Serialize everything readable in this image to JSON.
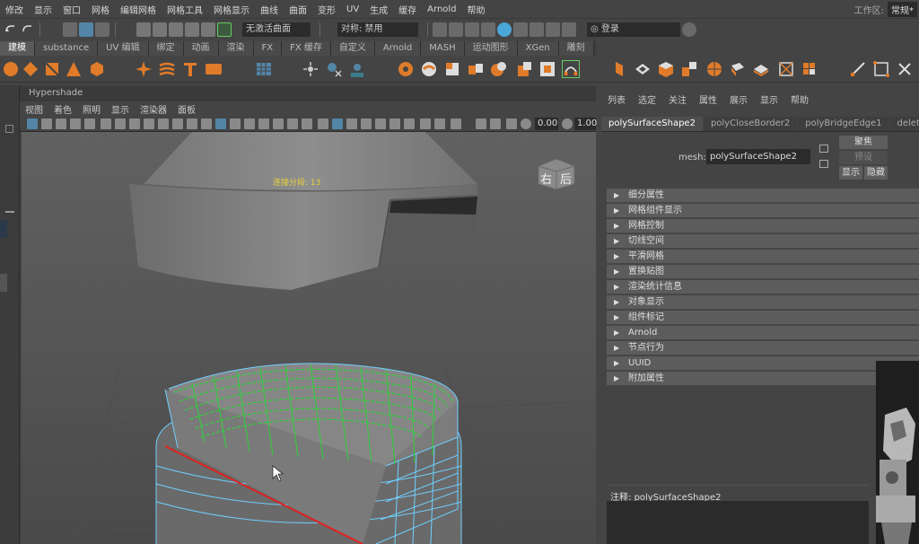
{
  "menubar": {
    "items": [
      "修改",
      "显示",
      "窗口",
      "网格",
      "编辑网格",
      "网格工具",
      "网格显示",
      "曲线",
      "曲面",
      "变形",
      "UV",
      "生成",
      "缓存",
      "Arnold",
      "帮助"
    ],
    "workspace_label": "工作区:",
    "workspace_value": "常规*"
  },
  "statusline": {
    "live_surface": "无激活曲面",
    "symmetry": "对称: 禁用",
    "login": "登录"
  },
  "shelf": {
    "tabs": [
      "建模",
      "substance",
      "UV 编辑",
      "绑定",
      "动画",
      "渲染",
      "FX",
      "FX 缓存",
      "自定义",
      "Arnold",
      "MASH",
      "运动图形",
      "XGen",
      "雕刻"
    ],
    "active_tab": 0
  },
  "viewport": {
    "panel_title": "Hypershade",
    "menu": [
      "视图",
      "着色",
      "照明",
      "显示",
      "渲染器",
      "面板"
    ],
    "near_clip": "0.00",
    "far_clip": "1.00",
    "hud_text": "连接分段: 13",
    "viewcube_right": "右",
    "viewcube_back": "后"
  },
  "attribute_editor": {
    "menu": [
      "列表",
      "选定",
      "关注",
      "属性",
      "展示",
      "显示",
      "帮助"
    ],
    "tabs": [
      "polySurfaceShape2",
      "polyCloseBorder2",
      "polyBridgeEdge1",
      "deleteCom"
    ],
    "mesh_label": "mesh:",
    "mesh_value": "polySurfaceShape2",
    "focus_button": "聚焦",
    "presets_button": "预设",
    "show_button": "显示",
    "hide_button": "隐藏",
    "sections": [
      "细分属性",
      "网格组件显示",
      "网格控制",
      "切线空间",
      "平滑网格",
      "置换贴图",
      "渲染统计信息",
      "对象显示",
      "组件标记",
      "Arnold",
      "节点行为",
      "UUID",
      "附加属性"
    ],
    "notes_label": "注释:",
    "notes_value": "polySurfaceShape2"
  },
  "colors": {
    "accent_orange": "#e07b2a",
    "active_blue": "#5285a6",
    "edge_green": "#2fd13a",
    "edge_red": "#e02020",
    "wire_cyan": "#6fd0ff",
    "hud_yellow": "#e8d23a"
  }
}
